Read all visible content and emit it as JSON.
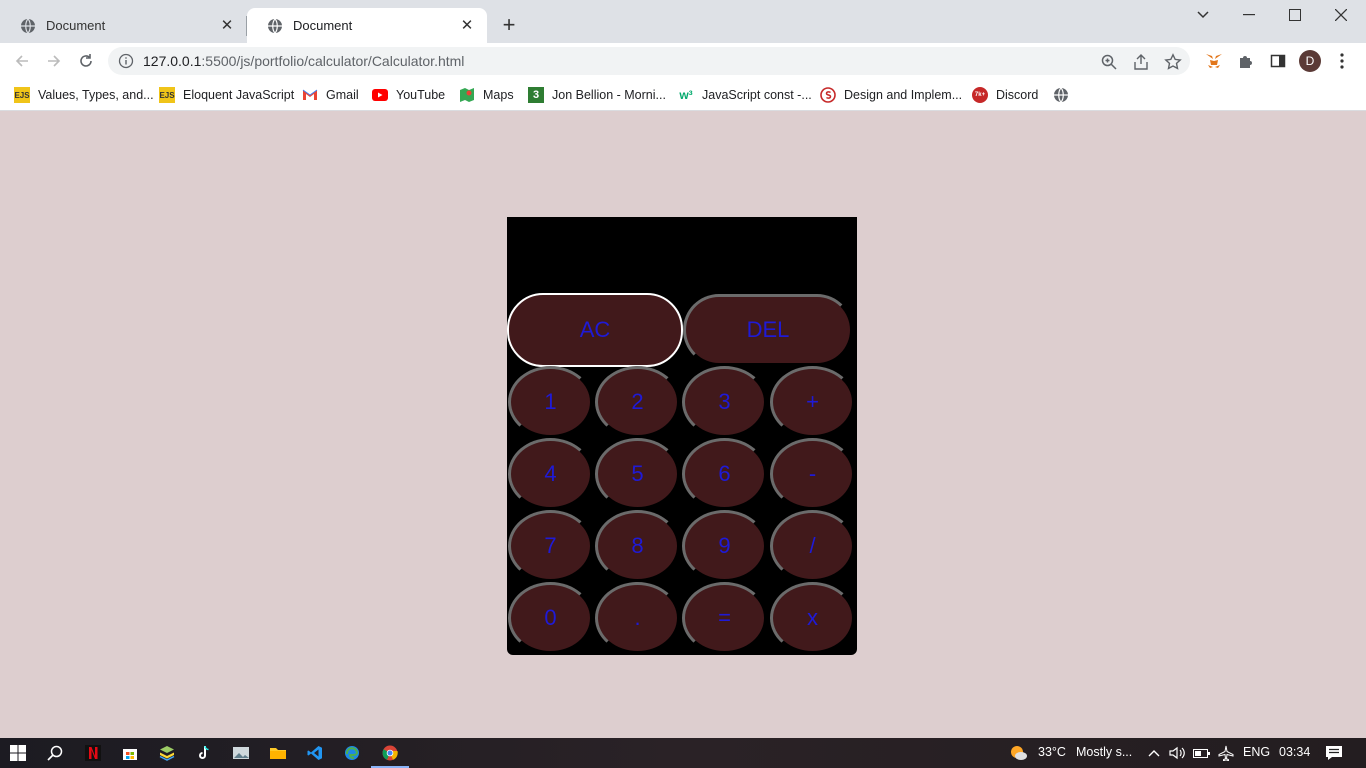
{
  "browser": {
    "tabs": [
      {
        "title": "Document",
        "active": false
      },
      {
        "title": "Document",
        "active": true
      }
    ],
    "url_host": "127.0.0.1",
    "url_path": ":5500/js/portfolio/calculator/Calculator.html",
    "profile_initial": "D"
  },
  "bookmarks": [
    {
      "label": "Values, Types, and...",
      "icon": "ejs-icon"
    },
    {
      "label": "Eloquent JavaScript",
      "icon": "ejs-icon"
    },
    {
      "label": "Gmail",
      "icon": "gmail-icon"
    },
    {
      "label": "YouTube",
      "icon": "youtube-icon"
    },
    {
      "label": "Maps",
      "icon": "maps-icon"
    },
    {
      "label": "Jon Bellion - Morni...",
      "icon": "bookmark-3-icon"
    },
    {
      "label": "JavaScript const -...",
      "icon": "w3schools-icon"
    },
    {
      "label": "Design and Implem...",
      "icon": "design-icon"
    },
    {
      "label": "Discord",
      "icon": "discord-icon"
    }
  ],
  "calculator": {
    "display": "",
    "keys": {
      "ac": "AC",
      "del": "DEL",
      "k1": "1",
      "k2": "2",
      "k3": "3",
      "plus": "+",
      "k4": "4",
      "k5": "5",
      "k6": "6",
      "minus": "-",
      "k7": "7",
      "k8": "8",
      "k9": "9",
      "divide": "/",
      "k0": "0",
      "dot": ".",
      "equals": "=",
      "multiply": "x"
    },
    "colors": {
      "key_bg": "#41191b",
      "key_text": "#1f1ad6",
      "body": "#000000",
      "page_bg": "#ddcecf"
    }
  },
  "taskbar": {
    "weather": "33°C",
    "weather_desc": "Mostly s...",
    "language": "ENG",
    "time": "03:34"
  }
}
